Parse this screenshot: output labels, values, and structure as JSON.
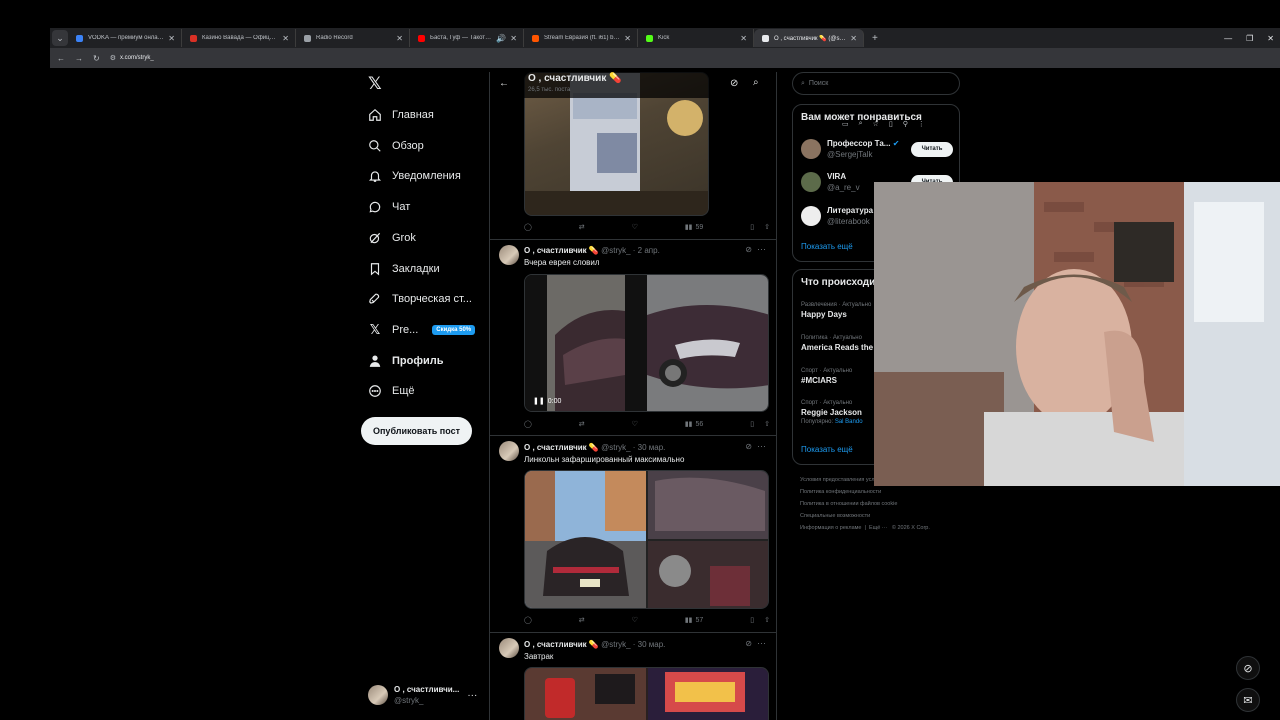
{
  "browser": {
    "tabs": [
      {
        "title": "VODKA — премиум онлайн-казино",
        "color": "#3b82f6"
      },
      {
        "title": "Казино Вавада — Официальный",
        "color": "#d93025"
      },
      {
        "title": "Radio Record",
        "color": "#9aa0a6"
      },
      {
        "title": "Баста, Гуф — Такот день (Ба",
        "color": "#ff0000"
      },
      {
        "title": "Stream Евразия (ft. i61) by PHARAOH",
        "color": "#ff5500"
      },
      {
        "title": "Kick",
        "color": "#53fc18"
      },
      {
        "title": "О , счастливчик 💊 (@stryk_)",
        "color": "#e8eaed"
      }
    ],
    "tab_new": "+",
    "url": "x.com/stryk_"
  },
  "sidebar": {
    "logo": "𝕏",
    "items": [
      {
        "label": "Главная",
        "icon": "home-icon"
      },
      {
        "label": "Обзор",
        "icon": "search-icon"
      },
      {
        "label": "Уведомления",
        "icon": "bell-icon"
      },
      {
        "label": "Чат",
        "icon": "chat-icon"
      },
      {
        "label": "Grok",
        "icon": "grok-icon"
      },
      {
        "label": "Закладки",
        "icon": "bookmark-icon"
      },
      {
        "label": "Творческая ст...",
        "icon": "rocket-icon"
      },
      {
        "label": "Pre...",
        "icon": "x-premium-icon",
        "badge": "Скидка 50%"
      },
      {
        "label": "Профиль",
        "icon": "person-icon"
      },
      {
        "label": "Ещё",
        "icon": "more-icon"
      }
    ],
    "post_button": "Опубликовать пост",
    "account": {
      "name": "О , счастливчи...",
      "handle": "@stryk_"
    }
  },
  "header": {
    "title": "О , счастливчик 💊",
    "subtitle": "26,5 тыс. поста"
  },
  "tweets": [
    {
      "actions": {
        "views": "59"
      }
    },
    {
      "name": "О , счастливчик 💊",
      "meta": "@stryk_ · 2 апр.",
      "text": "Вчера еврея словил",
      "video_time": "0:00",
      "actions": {
        "views": "56"
      }
    },
    {
      "name": "О , счастливчик 💊",
      "meta": "@stryk_ · 30 мар.",
      "text": "Линкольн зафаршированный максимально",
      "actions": {
        "views": "57"
      }
    },
    {
      "name": "О , счастливчик 💊",
      "meta": "@stryk_ · 30 мар.",
      "text": "Завтрак"
    }
  ],
  "right": {
    "search_placeholder": "Поиск",
    "who_to_follow": {
      "title": "Вам может понравиться",
      "people": [
        {
          "name": "Профессор Та...",
          "handle": "@SergejTalk",
          "verified": true,
          "color": "#8a7360"
        },
        {
          "name": "VIRA",
          "handle": "@a_re_v",
          "color": "#5c6b4a"
        },
        {
          "name": "Литература",
          "handle": "@literabook",
          "color": "#eeeeee"
        }
      ],
      "follow_label": "Читать",
      "show_more": "Показать ещё"
    },
    "trends": {
      "title": "Что происходит",
      "items": [
        {
          "category": "Развлечения · Актуально",
          "topic": "Happy Days"
        },
        {
          "category": "Политика · Актуально",
          "topic": "America Reads the"
        },
        {
          "category": "Спорт · Актуально",
          "topic": "#MCIARS"
        },
        {
          "category": "Спорт · Актуально",
          "topic": "Reggie Jackson",
          "popular_prefix": "Популярно:",
          "popular": "Sal Bando"
        }
      ],
      "show_more": "Показать ещё"
    },
    "footer": [
      "Условия предоставления услуг",
      "Политика конфиденциальности",
      "Политика в отношении файлов cookie",
      "Специальные возможности",
      "Информация о рекламе",
      "Ещё ···",
      "© 2026 X Corp."
    ]
  }
}
